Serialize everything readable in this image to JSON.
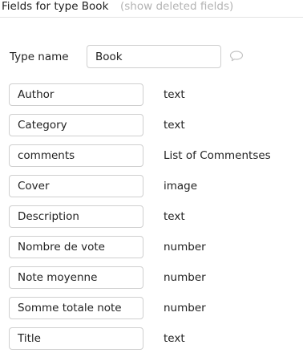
{
  "header": {
    "title": "Fields for type Book",
    "show_deleted_label": "(show deleted fields)"
  },
  "type_name": {
    "label": "Type name",
    "value": "Book"
  },
  "fields": [
    {
      "name": "Author",
      "type": "text"
    },
    {
      "name": "Category",
      "type": "text"
    },
    {
      "name": "comments",
      "type": "List of Commentses"
    },
    {
      "name": "Cover",
      "type": "image"
    },
    {
      "name": "Description",
      "type": "text"
    },
    {
      "name": "Nombre de vote",
      "type": "number"
    },
    {
      "name": "Note moyenne",
      "type": "number"
    },
    {
      "name": "Somme totale note",
      "type": "number"
    },
    {
      "name": "Title",
      "type": "text"
    }
  ],
  "icons": {
    "comment": "speech-bubble-icon"
  }
}
